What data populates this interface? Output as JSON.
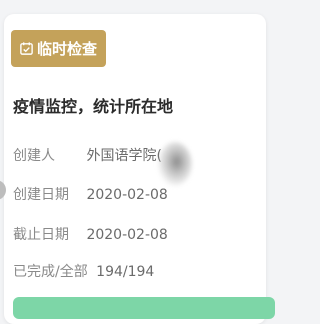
{
  "card": {
    "badge_label": "临时检查",
    "badge_icon": "calendar-check-icon",
    "title": "疫情监控，统计所在地",
    "rows": [
      {
        "label": "创建人",
        "value": "外国语学院("
      },
      {
        "label": "创建日期",
        "value": "2020-02-08"
      },
      {
        "label": "截止日期",
        "value": "2020-02-08"
      },
      {
        "label": "已完成/全部",
        "value": "194/194"
      }
    ],
    "progress_fraction": 1.0
  },
  "colors": {
    "badge": "#c4a25a",
    "progress": "#7dd6a7"
  }
}
